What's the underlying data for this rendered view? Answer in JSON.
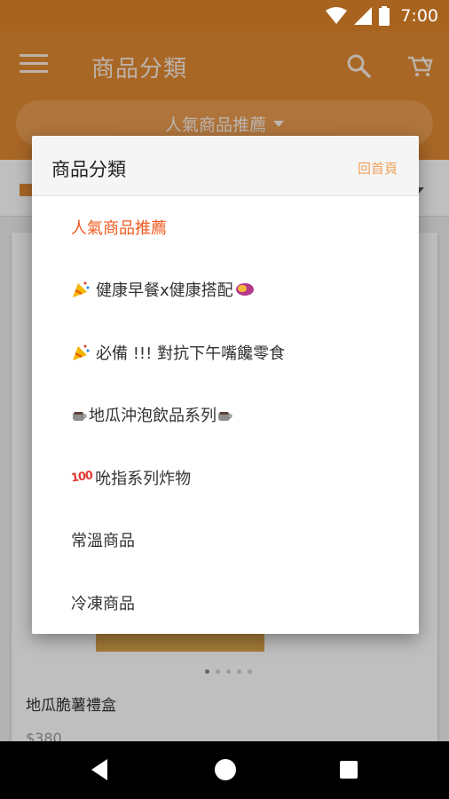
{
  "status_bar": {
    "time": "7:00",
    "icons": [
      "wifi-icon",
      "signal-icon",
      "battery-icon"
    ]
  },
  "app_bar": {
    "title": "商品分類",
    "icons": [
      "menu-icon",
      "search-icon",
      "cart-icon"
    ],
    "color": "#e28a33"
  },
  "category_selector": {
    "label": "人氣商品推薦"
  },
  "product": {
    "name": "地瓜脆薯禮盒",
    "price": "$380"
  },
  "dialog": {
    "title": "商品分類",
    "home_link": "回首頁",
    "accent_color": "#ef5a1f",
    "items": [
      {
        "label": "人氣商品推薦",
        "selected": true
      },
      {
        "label": "健康早餐x健康搭配",
        "icon": "party-popper-icon",
        "trailing_icon": "sweet-potato-icon"
      },
      {
        "label": "必備 !!! 對抗下午嘴饞零食",
        "icon": "party-popper-icon"
      },
      {
        "label": "地瓜沖泡飲品系列",
        "icon": "hot-beverage-icon",
        "trailing_icon": "hot-beverage-icon"
      },
      {
        "label": "吮指系列炸物",
        "icon": "hundred-points-icon",
        "icon_text": "100"
      },
      {
        "label": "常溫商品"
      },
      {
        "label": "冷凍商品"
      }
    ]
  },
  "nav_bar": {
    "icons": [
      "back-icon",
      "home-icon",
      "recent-apps-icon"
    ]
  }
}
